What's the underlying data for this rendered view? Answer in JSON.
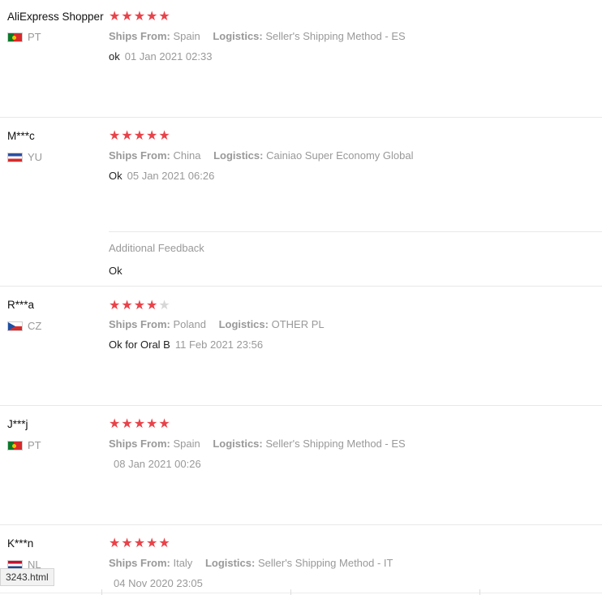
{
  "labels": {
    "ships_from": "Ships From:",
    "logistics": "Logistics:",
    "additional_feedback": "Additional Feedback"
  },
  "colors": {
    "star_on": "#e8434a",
    "star_off": "#d7d7d7",
    "muted_text": "#999999",
    "divider": "#e8e8e8"
  },
  "reviews": [
    {
      "name": "AliExpress Shopper",
      "country": "PT",
      "flag": "portugal-flag",
      "rating": 5,
      "ships_from": "Spain",
      "logistics": "Seller's Shipping Method - ES",
      "feedback": "ok",
      "date": "01 Jan 2021 02:33"
    },
    {
      "name": "M***c",
      "country": "YU",
      "flag": "yugoslavia-flag",
      "rating": 5,
      "ships_from": "China",
      "logistics": "Cainiao Super Economy Global",
      "feedback": "Ok",
      "date": "05 Jan 2021 06:26",
      "additional_feedback": "Ok"
    },
    {
      "name": "R***a",
      "country": "CZ",
      "flag": "czech-flag",
      "rating": 4,
      "ships_from": "Poland",
      "logistics": "OTHER PL",
      "feedback": "Ok for Oral B",
      "date": "11 Feb 2021 23:56"
    },
    {
      "name": "J***j",
      "country": "PT",
      "flag": "portugal-flag",
      "rating": 5,
      "ships_from": "Spain",
      "logistics": "Seller's Shipping Method - ES",
      "feedback": "",
      "date": "08 Jan 2021 00:26"
    },
    {
      "name": "K***n",
      "country": "NL",
      "flag": "netherlands-flag",
      "rating": 5,
      "ships_from": "Italy",
      "logistics": "Seller's Shipping Method - IT",
      "feedback": "",
      "date": "04 Nov 2020 23:05"
    }
  ],
  "statusbar": {
    "text": "3243.html"
  }
}
